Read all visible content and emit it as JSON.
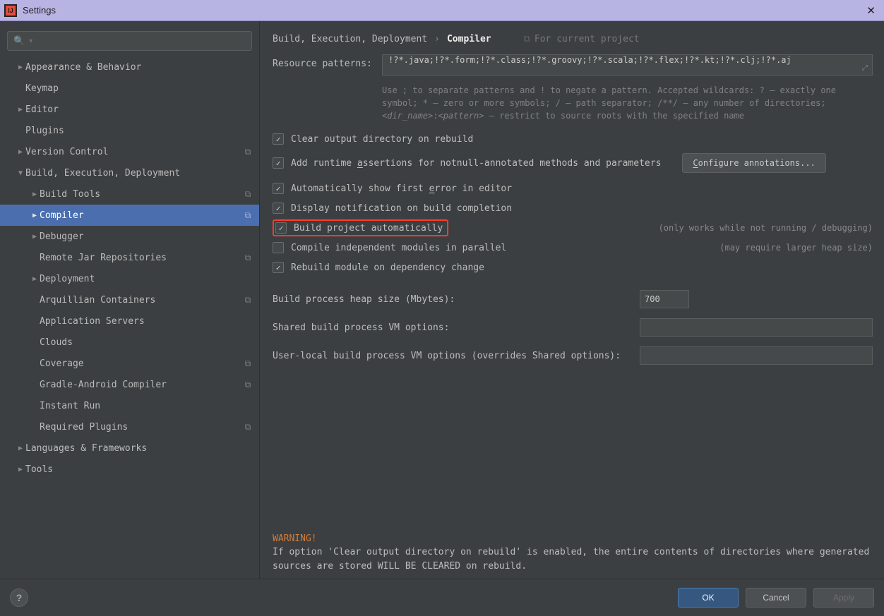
{
  "window": {
    "title": "Settings"
  },
  "search": {
    "placeholder": ""
  },
  "sidebar": [
    {
      "label": "Appearance & Behavior",
      "level": 0,
      "arrow": "▶",
      "copy": false
    },
    {
      "label": "Keymap",
      "level": 0,
      "arrow": "",
      "copy": false
    },
    {
      "label": "Editor",
      "level": 0,
      "arrow": "▶",
      "copy": false
    },
    {
      "label": "Plugins",
      "level": 0,
      "arrow": "",
      "copy": false
    },
    {
      "label": "Version Control",
      "level": 0,
      "arrow": "▶",
      "copy": true
    },
    {
      "label": "Build, Execution, Deployment",
      "level": 0,
      "arrow": "▼",
      "copy": false
    },
    {
      "label": "Build Tools",
      "level": 1,
      "arrow": "▶",
      "copy": true
    },
    {
      "label": "Compiler",
      "level": 1,
      "arrow": "▶",
      "copy": true,
      "selected": true
    },
    {
      "label": "Debugger",
      "level": 1,
      "arrow": "▶",
      "copy": false
    },
    {
      "label": "Remote Jar Repositories",
      "level": 1,
      "arrow": "",
      "copy": true
    },
    {
      "label": "Deployment",
      "level": 1,
      "arrow": "▶",
      "copy": false
    },
    {
      "label": "Arquillian Containers",
      "level": 1,
      "arrow": "",
      "copy": true
    },
    {
      "label": "Application Servers",
      "level": 1,
      "arrow": "",
      "copy": false
    },
    {
      "label": "Clouds",
      "level": 1,
      "arrow": "",
      "copy": false
    },
    {
      "label": "Coverage",
      "level": 1,
      "arrow": "",
      "copy": true
    },
    {
      "label": "Gradle-Android Compiler",
      "level": 1,
      "arrow": "",
      "copy": true
    },
    {
      "label": "Instant Run",
      "level": 1,
      "arrow": "",
      "copy": false
    },
    {
      "label": "Required Plugins",
      "level": 1,
      "arrow": "",
      "copy": true
    },
    {
      "label": "Languages & Frameworks",
      "level": 0,
      "arrow": "▶",
      "copy": false
    },
    {
      "label": "Tools",
      "level": 0,
      "arrow": "▶",
      "copy": false
    }
  ],
  "breadcrumb": {
    "path1": "Build, Execution, Deployment",
    "path2": "Compiler",
    "scope": "For current project"
  },
  "form": {
    "resource_patterns_label": "Resource patterns:",
    "resource_patterns_value": "!?*.java;!?*.form;!?*.class;!?*.groovy;!?*.scala;!?*.flex;!?*.kt;!?*.clj;!?*.aj",
    "resource_patterns_hint": "Use ; to separate patterns and ! to negate a pattern. Accepted wildcards: ? — exactly one symbol; * — zero or more symbols; / — path separator; /**/ — any number of directories; <dir_name>:<pattern> — restrict to source roots with the specified name",
    "chk_clear_output": "Clear output directory on rebuild",
    "chk_add_runtime": "Add runtime assertions for notnull-annotated methods and parameters",
    "btn_configure_annotations": "Configure annotations...",
    "chk_auto_first_error": "Automatically show first error in editor",
    "chk_display_notification": "Display notification on build completion",
    "chk_build_auto": "Build project automatically",
    "chk_build_auto_note": "(only works while not running / debugging)",
    "chk_compile_parallel": "Compile independent modules in parallel",
    "chk_compile_parallel_note": "(may require larger heap size)",
    "chk_rebuild_dep": "Rebuild module on dependency change",
    "heap_label": "Build process heap size (Mbytes):",
    "heap_value": "700",
    "shared_vm_label": "Shared build process VM options:",
    "shared_vm_value": "",
    "user_vm_label": "User-local build process VM options (overrides Shared options):",
    "user_vm_value": ""
  },
  "warning": {
    "title": "WARNING!",
    "body": "If option 'Clear output directory on rebuild' is enabled, the entire contents of directories where generated sources are stored WILL BE CLEARED on rebuild."
  },
  "buttons": {
    "ok": "OK",
    "cancel": "Cancel",
    "apply": "Apply"
  }
}
